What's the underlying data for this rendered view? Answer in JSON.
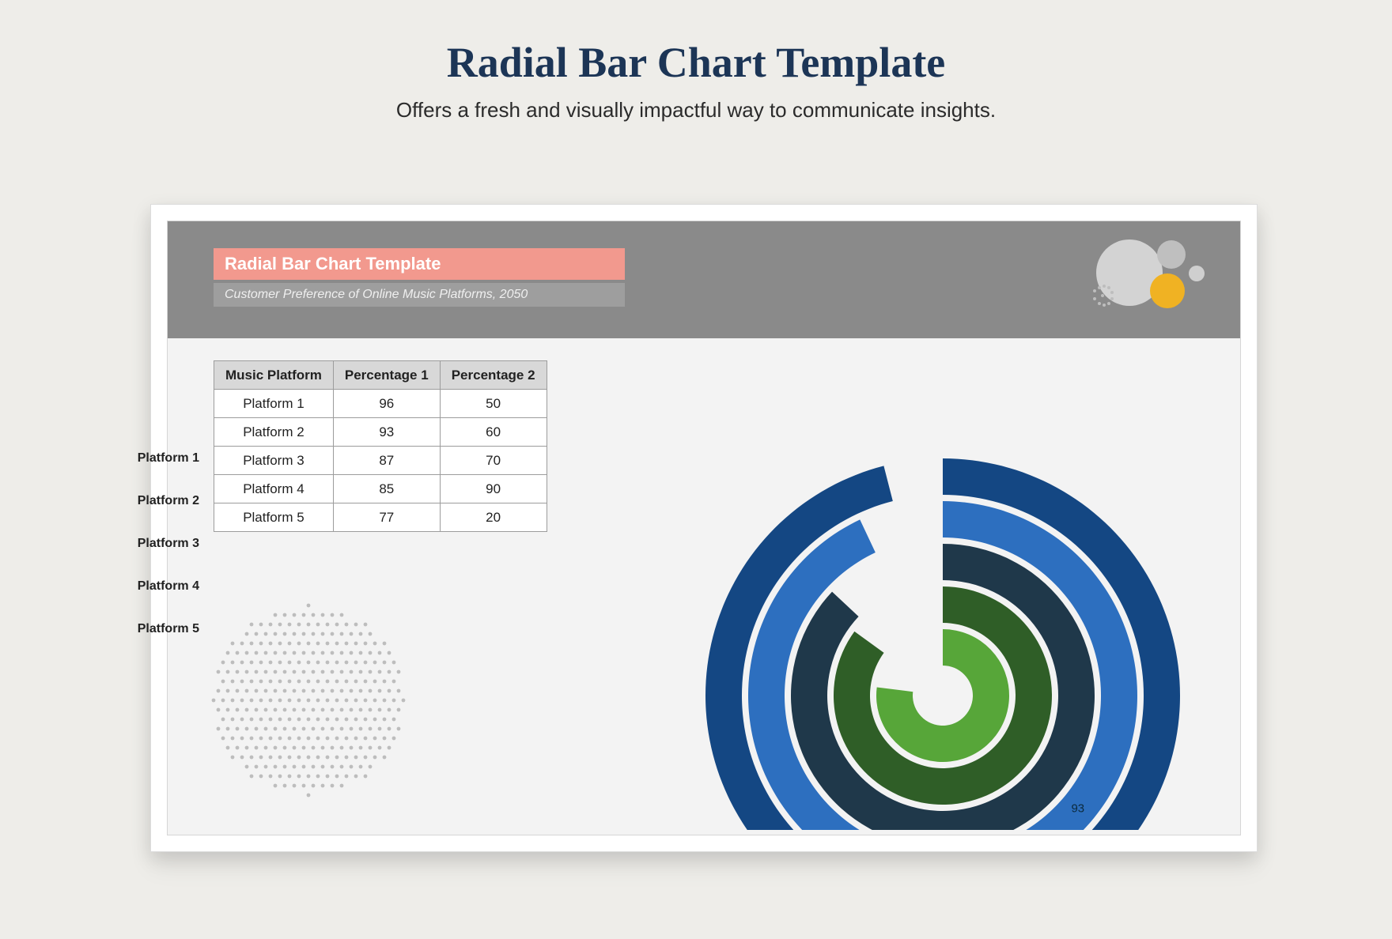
{
  "page": {
    "title": "Radial Bar Chart Template",
    "subtitle": "Offers a fresh and visually impactful way to communicate insights."
  },
  "card": {
    "title": "Radial Bar Chart Template",
    "subtitle": "Customer Preference of Online Music Platforms, 2050"
  },
  "table": {
    "headers": [
      "Music Platform",
      "Percentage 1",
      "Percentage 2"
    ],
    "rows": [
      {
        "platform": "Platform 1",
        "p1": 96,
        "p2": 50
      },
      {
        "platform": "Platform 2",
        "p1": 93,
        "p2": 60
      },
      {
        "platform": "Platform 3",
        "p1": 87,
        "p2": 70
      },
      {
        "platform": "Platform 4",
        "p1": 85,
        "p2": 90
      },
      {
        "platform": "Platform 5",
        "p1": 77,
        "p2": 20
      }
    ]
  },
  "chart_data": {
    "type": "bar",
    "title": "Radial Bar Chart Template",
    "subtitle": "Customer Preference of Online Music Platforms, 2050",
    "categories": [
      "Platform 1",
      "Platform 2",
      "Platform 3",
      "Platform 4",
      "Platform 5"
    ],
    "series": [
      {
        "name": "Percentage 1",
        "values": [
          96,
          93,
          87,
          85,
          77
        ]
      },
      {
        "name": "Percentage 2",
        "values": [
          50,
          60,
          70,
          90,
          20
        ]
      }
    ],
    "colors": [
      "#144783",
      "#2d6fbf",
      "#1f384a",
      "#2f5e27",
      "#57a639"
    ],
    "annotations": [
      {
        "text": "93",
        "series": "Percentage 1",
        "category": "Platform 2"
      }
    ],
    "xlabel": "",
    "ylabel": "",
    "ylim": [
      0,
      100
    ]
  },
  "colors": {
    "page_bg": "#eeede9",
    "title": "#1c3556",
    "band": "#8a8a8a",
    "title_box": "#f2998e",
    "accent_yellow": "#f0b223"
  }
}
